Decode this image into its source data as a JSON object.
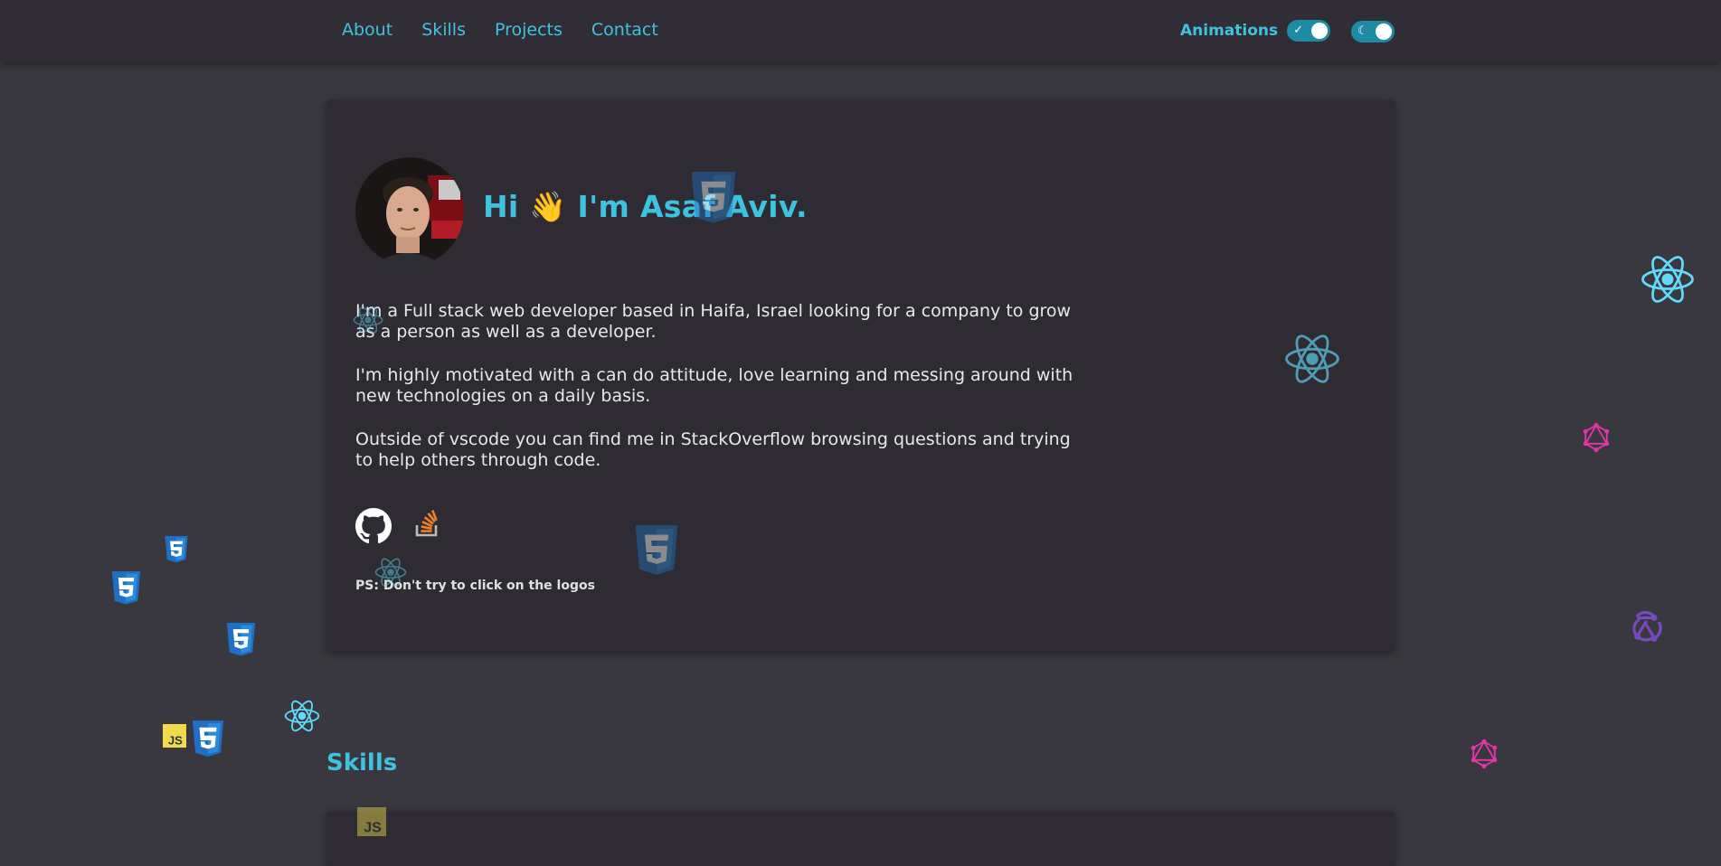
{
  "nav": {
    "items": [
      {
        "label": "About"
      },
      {
        "label": "Skills"
      },
      {
        "label": "Projects"
      },
      {
        "label": "Contact"
      }
    ],
    "animations_label": "Animations",
    "animations_toggle_glyph": "✓",
    "theme_toggle_glyph": "☾"
  },
  "hero": {
    "greeting": "Hi 👋 I'm Asaf Aviv.",
    "paragraphs": [
      "I'm a Full stack web developer based in Haifa, Israel looking for a company to grow as a person as well as a developer.",
      "I'm highly motivated with a can do attitude, love learning and messing around with new technologies on a daily basis.",
      "Outside of vscode you can find me in StackOverflow browsing questions and trying to help others through code."
    ],
    "social_icons": [
      "github-icon",
      "stackoverflow-icon"
    ],
    "ps_note": "PS: Don't try to click on the logos"
  },
  "skills": {
    "heading": "Skills"
  },
  "floating_logos": [
    "css3",
    "react",
    "javascript",
    "graphql",
    "redux"
  ],
  "colors": {
    "accent": "#3ec2e0",
    "background": "#3a383f",
    "card": "#2e2c32",
    "topbar": "#302e34",
    "css3": "#1f6fc5",
    "react": "#61dafb",
    "graphql": "#e535ab",
    "redux": "#764abc",
    "javascript": "#f0db4f"
  }
}
